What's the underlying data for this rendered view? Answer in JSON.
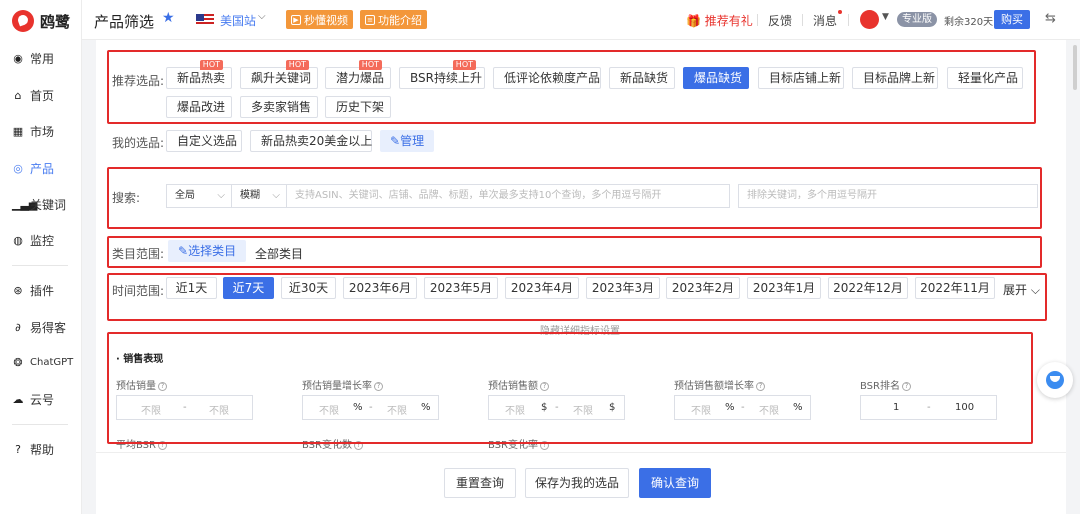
{
  "brand": {
    "name": "鸥鹭"
  },
  "sidebar": {
    "items": [
      {
        "label": "常用",
        "icon": "bookmark-icon"
      },
      {
        "label": "首页",
        "icon": "home-icon"
      },
      {
        "label": "市场",
        "icon": "grid-icon"
      },
      {
        "label": "产品",
        "icon": "product-icon",
        "active": true
      },
      {
        "label": "关键词",
        "icon": "bar-chart-icon"
      },
      {
        "label": "监控",
        "icon": "monitor-icon"
      },
      {
        "label": "插件",
        "icon": "plugin-icon"
      },
      {
        "label": "易得客",
        "icon": "link-icon"
      },
      {
        "label": "ChatGPT",
        "icon": "chatgpt-icon"
      },
      {
        "label": "云号",
        "icon": "cloud-icon"
      },
      {
        "label": "帮助",
        "icon": "help-icon"
      }
    ]
  },
  "header": {
    "title": "产品筛选",
    "site": "美国站",
    "video_btn": "秒懂视频",
    "intro_btn": "功能介绍",
    "referral": "推荐有礼",
    "feedback": "反馈",
    "messages": "消息",
    "plan": "专业版",
    "remaining": "剩余320天",
    "buy": "购买"
  },
  "recommend": {
    "label": "推荐选品:",
    "chips": [
      {
        "label": "新品热卖",
        "hot": "HOT"
      },
      {
        "label": "飙升关键词",
        "hot": "HOT"
      },
      {
        "label": "潜力爆品",
        "hot": "HOT"
      },
      {
        "label": "BSR持续上升",
        "hot": "HOT"
      },
      {
        "label": "低评论依赖度产品"
      },
      {
        "label": "新品缺货"
      },
      {
        "label": "爆品缺货",
        "selected": true
      },
      {
        "label": "目标店铺上新"
      },
      {
        "label": "目标品牌上新"
      },
      {
        "label": "轻量化产品"
      },
      {
        "label": "爆品改进"
      },
      {
        "label": "多卖家销售"
      },
      {
        "label": "历史下架"
      }
    ]
  },
  "my_picks": {
    "label": "我的选品:",
    "chips": [
      "自定义选品",
      "新品热卖20美金以上"
    ],
    "manage": "管理"
  },
  "search": {
    "label": "搜索:",
    "scope": "全局",
    "match": "模糊",
    "placeholder": "支持ASIN、关键词、店铺、品牌、标题，单次最多支持10个查询，多个用逗号隔开",
    "exclude_placeholder": "排除关键词，多个用逗号隔开"
  },
  "category": {
    "label": "类目范围:",
    "select_btn": "选择类目",
    "value": "全部类目"
  },
  "time": {
    "label": "时间范围:",
    "options": [
      "近1天",
      "近7天",
      "近30天",
      "2023年6月",
      "2023年5月",
      "2023年4月",
      "2023年3月",
      "2023年2月",
      "2023年1月",
      "2022年12月",
      "2022年11月"
    ],
    "selected_index": 1,
    "expand": "展开"
  },
  "hide_settings": "隐藏详细指标设置",
  "sales": {
    "title": "销售表现",
    "metrics": [
      {
        "label": "预估销量",
        "min": "不限",
        "max": "不限",
        "unit": ""
      },
      {
        "label": "预估销量增长率",
        "min": "不限",
        "max": "不限",
        "unit": "%"
      },
      {
        "label": "预估销售额",
        "min": "不限",
        "max": "不限",
        "unit": "$"
      },
      {
        "label": "预估销售额增长率",
        "min": "不限",
        "max": "不限",
        "unit": "%"
      },
      {
        "label": "BSR排名",
        "min": "1",
        "max": "100",
        "unit": ""
      }
    ],
    "more_labels": [
      "平均BSR",
      "BSR变化数",
      "BSR变化率"
    ]
  },
  "actions": {
    "reset": "重置查询",
    "save": "保存为我的选品",
    "confirm": "确认查询"
  }
}
